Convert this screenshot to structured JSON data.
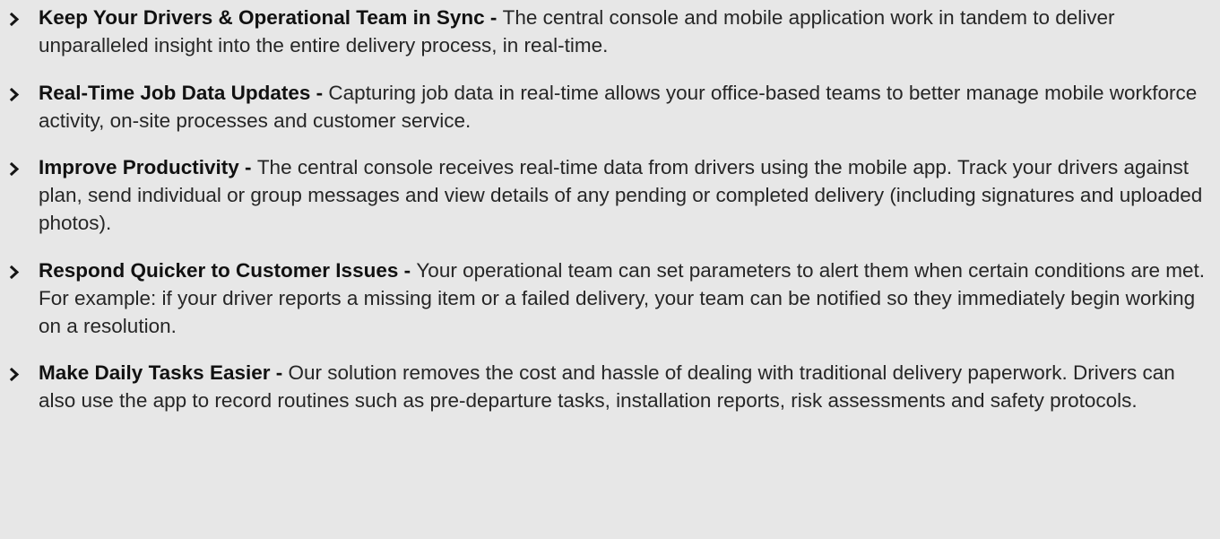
{
  "features": [
    {
      "icon": "chevron-right-icon",
      "title": "Keep Your Drivers & Operational Team in Sync -",
      "text": "The central console and mobile application work in tandem to deliver unparalleled insight into the entire delivery process, in real-time."
    },
    {
      "icon": "chevron-right-icon",
      "title": "Real-Time Job Data Updates  -",
      "text": "Capturing job data in real-time allows your office-based teams to better manage mobile workforce activity, on-site processes and customer service."
    },
    {
      "icon": "chevron-right-icon",
      "title": "Improve Productivity -",
      "text": "The central console receives real-time data from drivers using the mobile app. Track your drivers against plan, send individual or group messages and view details of any pending or completed delivery (including signatures and uploaded photos)."
    },
    {
      "icon": "chevron-right-icon",
      "title": "Respond Quicker to Customer Issues -",
      "text": " Your operational team can set parameters to alert them when certain conditions are met. For example: if your driver reports a missing item or a failed delivery, your team can be notified so they immediately begin working on a resolution."
    },
    {
      "icon": "chevron-right-icon",
      "title": "Make Daily Tasks Easier -",
      "text": "Our solution removes the cost and hassle of dealing with traditional delivery paperwork. Drivers can also use the app to record routines such as pre-departure tasks, installation reports, risk assessments and safety protocols."
    }
  ],
  "colors": {
    "background": "#e7e7e7",
    "text": "#262626",
    "title": "#111111",
    "icon": "#151515"
  }
}
